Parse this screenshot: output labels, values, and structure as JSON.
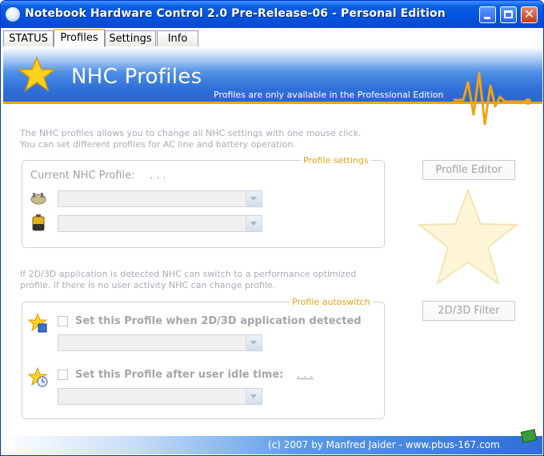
{
  "window": {
    "title": "Notebook Hardware Control 2.0 Pre-Release-06  -  Personal Edition",
    "controls": {
      "minimize_icon": "minimize-icon",
      "maximize_icon": "maximize-icon",
      "close_glyph": "✕"
    }
  },
  "tabs": [
    {
      "label": "STATUS",
      "active": false
    },
    {
      "label": "Profiles",
      "active": true
    },
    {
      "label": "Settings",
      "active": false
    },
    {
      "label": "Info",
      "active": false
    }
  ],
  "header": {
    "title": "NHC Profiles",
    "subtitle": "Profiles are only available in the Professional Edition",
    "accent_color": "#f2a20f"
  },
  "intro": {
    "line1": "The NHC profiles allows you to change all NHC settings with one mouse click.",
    "line2": "You can set different profiles for AC line and battery operation."
  },
  "profile_settings": {
    "legend": "Profile settings",
    "current_label": "Current NHC Profile:",
    "current_value": ". . .",
    "ac_combo": {
      "value": ""
    },
    "battery_combo": {
      "value": ""
    }
  },
  "autoswitch_intro": {
    "line1": "If 2D/3D application is detected NHC can switch to a performance optimized",
    "line2": "profile. If there is no user activity NHC can change profile."
  },
  "profile_autoswitch": {
    "legend": "Profile autoswitch",
    "app_detect": {
      "label": "Set this Profile when 2D/3D application detected",
      "checked": false
    },
    "idle": {
      "label": "Set this Profile after user idle time:",
      "value": ". . .",
      "checked": false
    }
  },
  "buttons": {
    "profile_editor": "Profile Editor",
    "filter": "2D/3D Filter"
  },
  "footer": {
    "text": "(c) 2007 by Manfred Jaider  -  www.pbus-167.com"
  }
}
